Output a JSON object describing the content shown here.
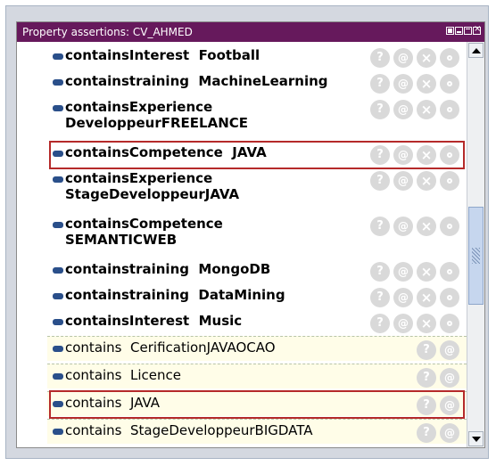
{
  "window": {
    "title": "Property assertions: CV_AHMED",
    "controls": [
      "menu-icon",
      "minimize-icon",
      "maximize-icon",
      "close-icon"
    ]
  },
  "assertions": [
    {
      "text": "containsInterest  Football",
      "style": "object"
    },
    {
      "text": "containstraining  MachineLearning",
      "style": "object"
    },
    {
      "text": "containsExperience\nDeveloppeurFREELANCE",
      "style": "object"
    },
    {
      "text": "containsCompetence  JAVA",
      "style": "object",
      "highlighted": true
    },
    {
      "text": "containsExperience\nStageDeveloppeurJAVA",
      "style": "object"
    },
    {
      "text": "containsCompetence\nSEMANTICWEB",
      "style": "object"
    },
    {
      "text": "containstraining  MongoDB",
      "style": "object"
    },
    {
      "text": "containstraining  DataMining",
      "style": "object"
    },
    {
      "text": "containsInterest  Music",
      "style": "object"
    },
    {
      "text": "contains  CerificationJAVAOCAO",
      "style": "data"
    },
    {
      "text": "contains  Licence",
      "style": "data"
    },
    {
      "text": "contains  JAVA",
      "style": "data",
      "highlighted": true
    },
    {
      "text": "contains  StageDeveloppeurBIGDATA",
      "style": "data"
    }
  ],
  "icons": {
    "object_row": [
      "help-icon",
      "annotation-icon",
      "delete-icon",
      "edit-icon"
    ],
    "data_row": [
      "help-icon",
      "annotation-icon"
    ]
  },
  "colors": {
    "title_bar": "#66195c",
    "highlight_border": "#b52a2a",
    "data_row_bg": "#fffde8",
    "bullet": "#2a4f8a",
    "icon_circle": "#d9d9d9"
  }
}
